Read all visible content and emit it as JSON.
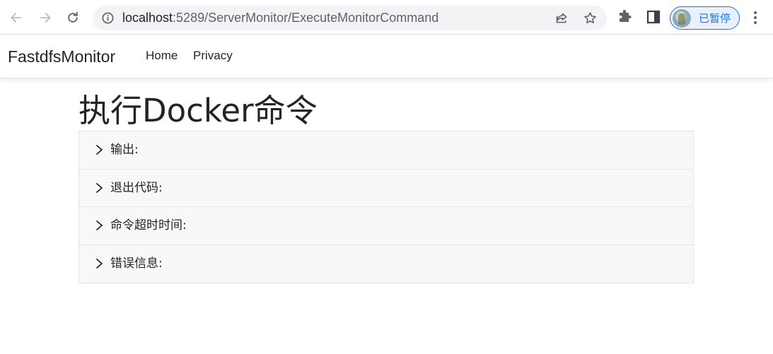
{
  "browser": {
    "url_host": "localhost",
    "url_rest": ":5289/ServerMonitor/ExecuteMonitorCommand",
    "profile_label": "已暂停",
    "accent_color": "#1a73e8"
  },
  "navbar": {
    "brand": "FastdfsMonitor",
    "links": [
      "Home",
      "Privacy"
    ]
  },
  "page": {
    "title": "执行Docker命令",
    "accordion": [
      {
        "label": "输出:"
      },
      {
        "label": "退出代码:"
      },
      {
        "label": "命令超时时间:"
      },
      {
        "label": "错误信息:"
      }
    ]
  },
  "icons": {
    "back": "arrow-left-icon",
    "forward": "arrow-right-icon",
    "reload": "reload-icon",
    "site_info": "info-icon",
    "share": "share-icon",
    "bookmark": "star-icon",
    "extensions": "puzzle-icon",
    "side_panel": "side-panel-icon",
    "menu": "more-vertical-icon",
    "accordion": "chevron-right-icon"
  }
}
